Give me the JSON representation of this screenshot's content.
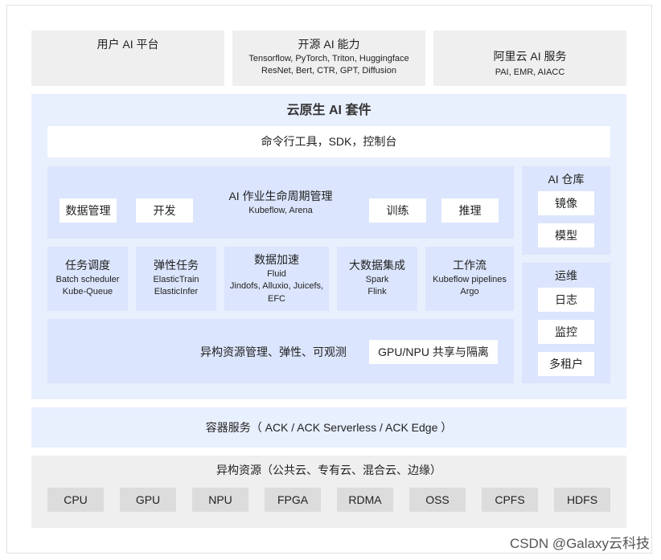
{
  "top": [
    {
      "title": "用户 AI 平台",
      "lines": []
    },
    {
      "title": "开源 AI 能力",
      "lines": [
        "Tensorflow, PyTorch, Triton, Huggingface",
        "ResNet, Bert, CTR, GPT, Diffusion"
      ]
    },
    {
      "title": "阿里云 AI 服务",
      "lines": [
        "PAI, EMR, AIACC"
      ]
    }
  ],
  "suite": {
    "title": "云原生 AI 套件",
    "cli_bar": "命令行工具，SDK，控制台",
    "lifecycle": {
      "title": "AI 作业生命周期管理",
      "subtitle": "Kubeflow, Arena",
      "buttons": [
        "数据管理",
        "开发",
        "训练",
        "推理"
      ]
    },
    "modules": [
      {
        "title": "任务调度",
        "lines": [
          "Batch scheduler",
          "Kube-Queue"
        ]
      },
      {
        "title": "弹性任务",
        "lines": [
          "ElasticTrain",
          "ElasticInfer"
        ]
      },
      {
        "title": "数据加速",
        "lines": [
          "Fluid",
          "Jindofs, Alluxio, Juicefs,",
          "EFC"
        ]
      },
      {
        "title": "大数据集成",
        "lines": [
          "Spark",
          "Flink"
        ]
      },
      {
        "title": "工作流",
        "lines": [
          "Kubeflow pipelines",
          "Argo"
        ]
      }
    ],
    "hetero": {
      "label": "异构资源管理、弹性、可观测",
      "button": "GPU/NPU 共享与隔离"
    },
    "repo": {
      "title": "AI 仓库",
      "items": [
        "镜像",
        "模型"
      ]
    },
    "ops": {
      "title": "运维",
      "items": [
        "日志",
        "监控",
        "多租户"
      ]
    }
  },
  "container": "容器服务（ ACK / ACK Serverless / ACK Edge ）",
  "resources": {
    "title": "异构资源（公共云、专有云、混合云、边缘）",
    "items": [
      "CPU",
      "GPU",
      "NPU",
      "FPGA",
      "RDMA",
      "OSS",
      "CPFS",
      "HDFS"
    ]
  },
  "watermark": "CSDN @Galaxy云科技",
  "colors": {
    "gray": "#efefef",
    "suite_bg": "#e8effd",
    "block": "#dbe5fd",
    "chip": "#dcdcdc"
  }
}
